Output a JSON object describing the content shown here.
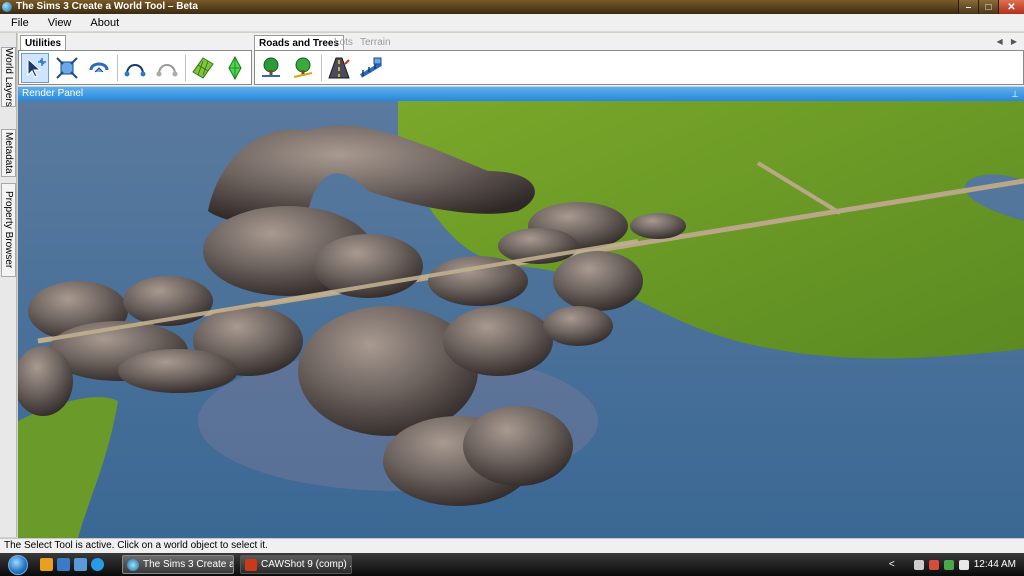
{
  "window": {
    "title": "The Sims 3 Create a World Tool – Beta",
    "controls": [
      "–",
      "□",
      "✕"
    ]
  },
  "menu": [
    "File",
    "View",
    "About"
  ],
  "left_tabs": [
    "World Layers",
    "Metadata",
    "Property Browser"
  ],
  "ribbon": {
    "utilities_tab": "Utilities",
    "roads_tab": "Roads and Trees",
    "lots_tab": "Lots",
    "terrain_tab": "Terrain",
    "scroll": "◀ ▶",
    "utility_tools": [
      "select-tool-icon",
      "move-tool-icon",
      "rotate-tool-icon",
      "arc-tool-icon",
      "arc-disabled-icon",
      "terrain-grid-icon",
      "sims-plumbob-icon"
    ],
    "road_tools": [
      "tree-paint-icon",
      "tree-erase-icon",
      "road-tool-icon",
      "bridge-tool-icon"
    ]
  },
  "render_panel": {
    "title": "Render Panel",
    "pin": "⊥"
  },
  "status": {
    "text": "The Select Tool is active. Click on a world object to select it."
  },
  "taskbar": {
    "tasks": [
      "The Sims 3 Create a ...",
      "CAWShot 9 (comp) ..."
    ],
    "tray_chevron": "<",
    "clock": "12:44 AM"
  },
  "colors": {
    "title_bar": "#5a4018",
    "render_header": "#3a98e0",
    "water": "#3f6c9a",
    "grass": "#6a9a2a",
    "road": "#b9a888"
  }
}
